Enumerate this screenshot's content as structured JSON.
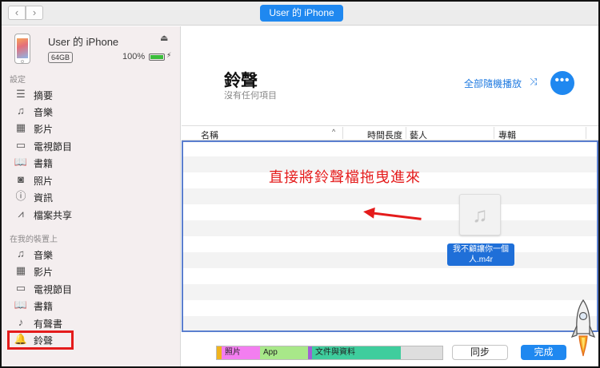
{
  "window": {
    "device_pill": "User 的 iPhone",
    "nav_back": "‹",
    "nav_forward": "›"
  },
  "sidebar": {
    "device": {
      "name": "User 的 iPhone",
      "capacity": "64GB",
      "battery": "100%",
      "battery_level": 1.0,
      "eject_icon": "eject-icon"
    },
    "settings_title": "設定",
    "settings_items": [
      {
        "label": "摘要",
        "icon": "summary-icon"
      },
      {
        "label": "音樂",
        "icon": "music-icon"
      },
      {
        "label": "影片",
        "icon": "movie-icon"
      },
      {
        "label": "電視節目",
        "icon": "tv-icon"
      },
      {
        "label": "書籍",
        "icon": "book-icon"
      },
      {
        "label": "照片",
        "icon": "camera-icon"
      },
      {
        "label": "資訊",
        "icon": "info-icon"
      },
      {
        "label": "檔案共享",
        "icon": "app-store-icon"
      }
    ],
    "ondevice_title": "在我的裝置上",
    "ondevice_items": [
      {
        "label": "音樂",
        "icon": "music-icon"
      },
      {
        "label": "影片",
        "icon": "movie-icon"
      },
      {
        "label": "電視節目",
        "icon": "tv-icon"
      },
      {
        "label": "書籍",
        "icon": "book-icon"
      },
      {
        "label": "有聲書",
        "icon": "audiobook-icon"
      },
      {
        "label": "鈴聲",
        "icon": "bell-icon",
        "selected": true
      }
    ]
  },
  "main": {
    "title": "鈴聲",
    "subtitle": "沒有任何項目",
    "shuffle_all": "全部隨機播放",
    "more_button": "•••",
    "columns": [
      "名稱",
      "時間長度",
      "藝人",
      "專輯"
    ],
    "annotation": "直接將鈴聲檔拖曳進來",
    "dragged_file": "我不顧讓你一個人.m4r",
    "colors": {
      "accent": "#1f88f0",
      "annotation": "#e41b1b",
      "drop_border": "#5b7fcf"
    }
  },
  "footer": {
    "storage": [
      {
        "label": "",
        "color": "#f0b41e"
      },
      {
        "label": "照片",
        "color": "#f37ef0"
      },
      {
        "label": "App",
        "color": "#a8e889"
      },
      {
        "label": "",
        "color": "#a15fd6"
      },
      {
        "label": "文件與資料",
        "color": "#3fcd9d"
      },
      {
        "label": "",
        "color": "#dedede"
      }
    ],
    "sync_button": "同步",
    "done_button": "完成"
  }
}
